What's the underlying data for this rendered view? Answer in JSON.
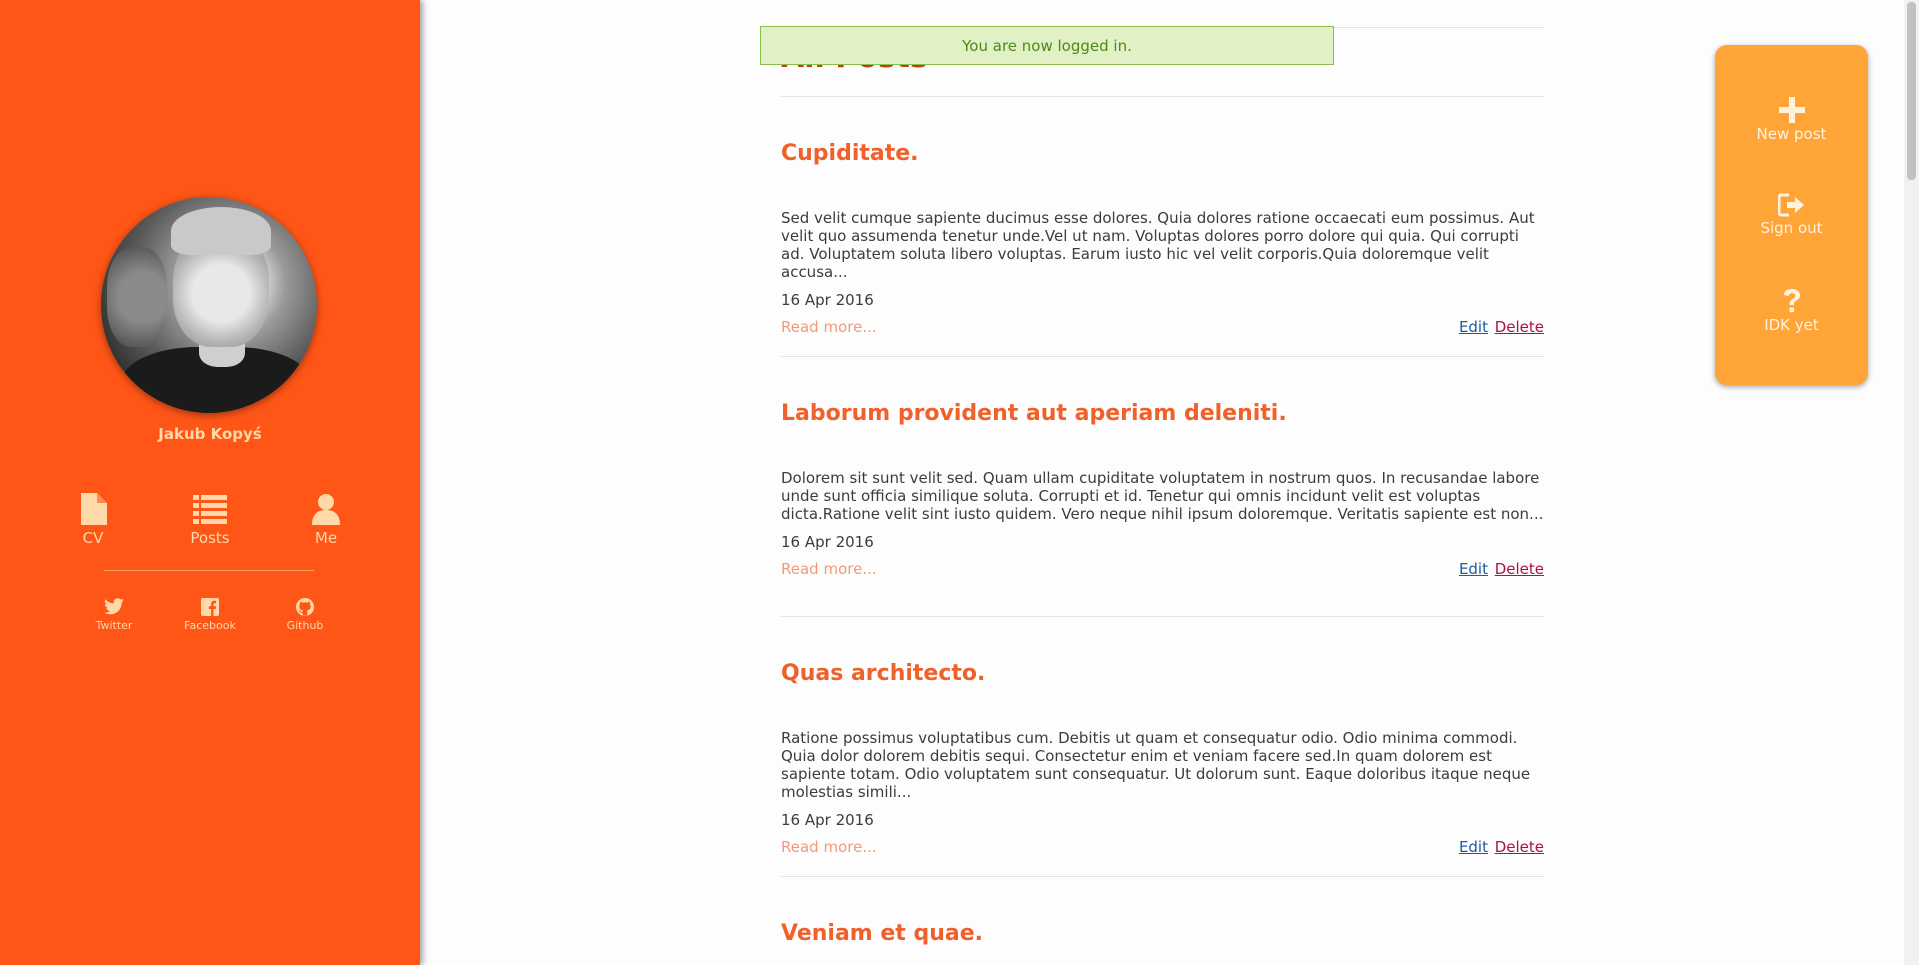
{
  "sidebar": {
    "author_name": "Jakub Kopyś",
    "nav": [
      {
        "label": "CV",
        "icon": "file-icon"
      },
      {
        "label": "Posts",
        "icon": "list-icon"
      },
      {
        "label": "Me",
        "icon": "user-icon"
      }
    ],
    "social": [
      {
        "label": "Twitter",
        "icon": "twitter-icon"
      },
      {
        "label": "Facebook",
        "icon": "facebook-icon"
      },
      {
        "label": "Github",
        "icon": "github-icon"
      }
    ]
  },
  "flash": {
    "message": "You are now logged in."
  },
  "main": {
    "title": "All Posts",
    "posts": [
      {
        "title": "Cupiditate.",
        "excerpt": "Sed velit cumque sapiente ducimus esse dolores. Quia dolores ratione occaecati eum possimus. Aut velit quo assumenda tenetur unde.Vel ut nam. Voluptas dolores porro dolore qui quia. Qui corrupti ad. Voluptatem soluta libero voluptas. Earum iusto hic vel velit corporis.Quia doloremque velit accusa...",
        "date": "16 Apr 2016",
        "read_more": "Read more...",
        "edit": "Edit",
        "delete": "Delete"
      },
      {
        "title": "Laborum provident aut aperiam deleniti.",
        "excerpt": "Dolorem sit sunt velit sed. Quam ullam cupiditate voluptatem in nostrum quos. In recusandae labore unde sunt officia similique soluta. Corrupti et id. Tenetur qui omnis incidunt velit est voluptas dicta.Ratione velit sint iusto quidem. Vero neque nihil ipsum doloremque. Veritatis sapiente est non...",
        "date": "16 Apr 2016",
        "read_more": "Read more...",
        "edit": "Edit",
        "delete": "Delete"
      },
      {
        "title": "Quas architecto.",
        "excerpt": "Ratione possimus voluptatibus cum. Debitis ut quam et consequatur odio. Odio minima commodi. Quia dolor dolorem debitis sequi. Consectetur enim et veniam facere sed.In quam dolorem est sapiente totam. Odio voluptatem sunt consequatur. Ut dolorum sunt. Eaque doloribus itaque neque molestias simili...",
        "date": "16 Apr 2016",
        "read_more": "Read more...",
        "edit": "Edit",
        "delete": "Delete"
      },
      {
        "title": "Veniam et quae."
      }
    ]
  },
  "actions": [
    {
      "label": "New post",
      "icon": "plus-icon"
    },
    {
      "label": "Sign out",
      "icon": "sign-out-icon"
    },
    {
      "label": "IDK yet",
      "icon": "question-icon"
    }
  ],
  "colors": {
    "sidebar": "#ff5516",
    "accent": "#f0602a",
    "panel": "#ffa436",
    "flash_bg": "#e1f0c5"
  }
}
